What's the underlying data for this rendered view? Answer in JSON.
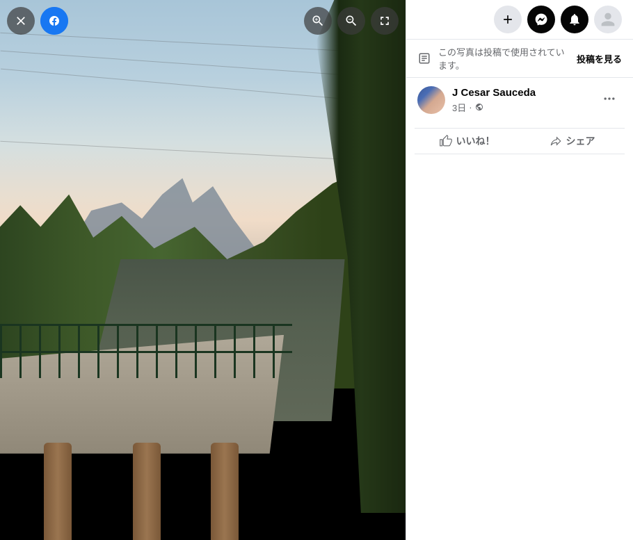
{
  "infoBar": {
    "text": "この写真は投稿で使用されています。",
    "viewPostLabel": "投稿を見る"
  },
  "post": {
    "author": "J Cesar Sauceda",
    "timestamp": "3日",
    "separator": " · "
  },
  "actions": {
    "like": "いいね！",
    "share": "シェア"
  }
}
